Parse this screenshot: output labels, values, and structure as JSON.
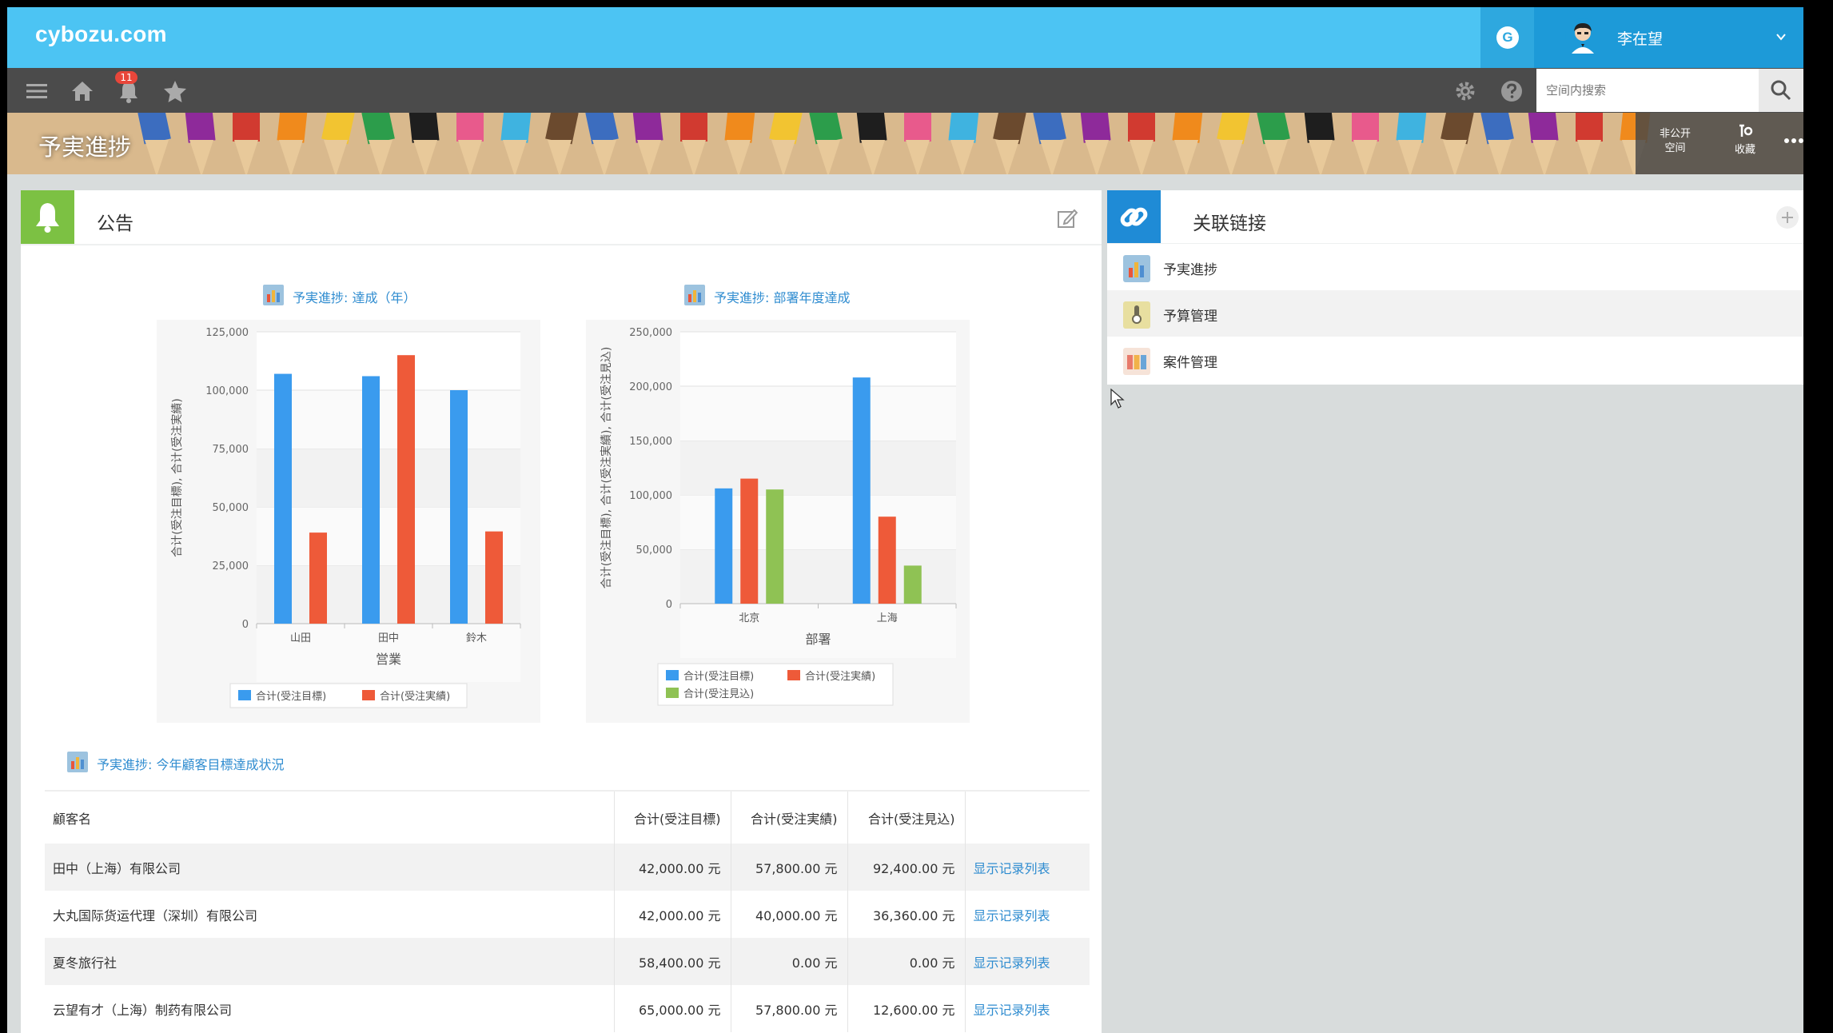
{
  "header": {
    "logo": "cybozu.com",
    "g_label": "G",
    "user_name": "李在望",
    "notification_count": "11",
    "search_placeholder": "空间内搜索"
  },
  "space": {
    "title": "予実進捗",
    "private_label_1": "非公开",
    "private_label_2": "空间",
    "favorite_label": "收藏"
  },
  "notice": {
    "title": "公告",
    "chart1_link": "予実進捗: 達成（年）",
    "chart2_link": "予実進捗: 部署年度達成",
    "table_link": "予実進捗: 今年顧客目標達成状況"
  },
  "chart_data": [
    {
      "type": "bar",
      "categories": [
        "山田",
        "田中",
        "鈴木"
      ],
      "series": [
        {
          "name": "合计(受注目標)",
          "values": [
            107000,
            106000,
            100000
          ],
          "color": "#3a9bee"
        },
        {
          "name": "合计(受注実績)",
          "values": [
            39000,
            115000,
            39500
          ],
          "color": "#ee5a39"
        }
      ],
      "xlabel": "営業",
      "ylabel": "合计(受注目標), 合计(受注実績)",
      "ylim": [
        0,
        125000
      ],
      "yticks": [
        "0",
        "25,000",
        "50,000",
        "75,000",
        "100,000",
        "125,000"
      ],
      "grid": true,
      "legend": "bottom"
    },
    {
      "type": "bar",
      "categories": [
        "北京",
        "上海"
      ],
      "series": [
        {
          "name": "合计(受注目標)",
          "values": [
            106000,
            208000
          ],
          "color": "#3a9bee"
        },
        {
          "name": "合计(受注実績)",
          "values": [
            115000,
            80000
          ],
          "color": "#ee5a39"
        },
        {
          "name": "合计(受注見込)",
          "values": [
            105000,
            35000
          ],
          "color": "#8fc254"
        }
      ],
      "xlabel": "部署",
      "ylabel": "合计(受注目標), 合计(受注実績), 合计(受注見込)",
      "ylim": [
        0,
        250000
      ],
      "yticks": [
        "0",
        "50,000",
        "100,000",
        "150,000",
        "200,000",
        "250,000"
      ],
      "grid": true,
      "legend": "bottom"
    }
  ],
  "table": {
    "headers": [
      "顧客名",
      "合计(受注目標)",
      "合计(受注実績)",
      "合计(受注見込)",
      ""
    ],
    "rows": [
      [
        "田中（上海）有限公司",
        "42,000.00 元",
        "57,800.00 元",
        "92,400.00 元",
        "显示记录列表"
      ],
      [
        "大丸国际货运代理（深圳）有限公司",
        "42,000.00 元",
        "40,000.00 元",
        "36,360.00 元",
        "显示记录列表"
      ],
      [
        "夏冬旅行社",
        "58,400.00 元",
        "0.00 元",
        "0.00 元",
        "显示记录列表"
      ],
      [
        "云望有才（上海）制药有限公司",
        "65,000.00 元",
        "57,800.00 元",
        "12,600.00 元",
        "显示记录列表"
      ]
    ]
  },
  "links": {
    "title": "关联链接",
    "items": [
      {
        "label": "予実進捗",
        "icon": "bar-chart-app-icon"
      },
      {
        "label": "予算管理",
        "icon": "budget-app-icon"
      },
      {
        "label": "案件管理",
        "icon": "deals-app-icon"
      }
    ]
  },
  "colors": {
    "topbar": "#4cc4f3",
    "user_box": "#1d9ad8",
    "toolbar": "#4b4b4b",
    "link": "#2f8cd0",
    "notice_icon_bg": "#7cc143",
    "links_icon_bg": "#1f8bd6"
  }
}
